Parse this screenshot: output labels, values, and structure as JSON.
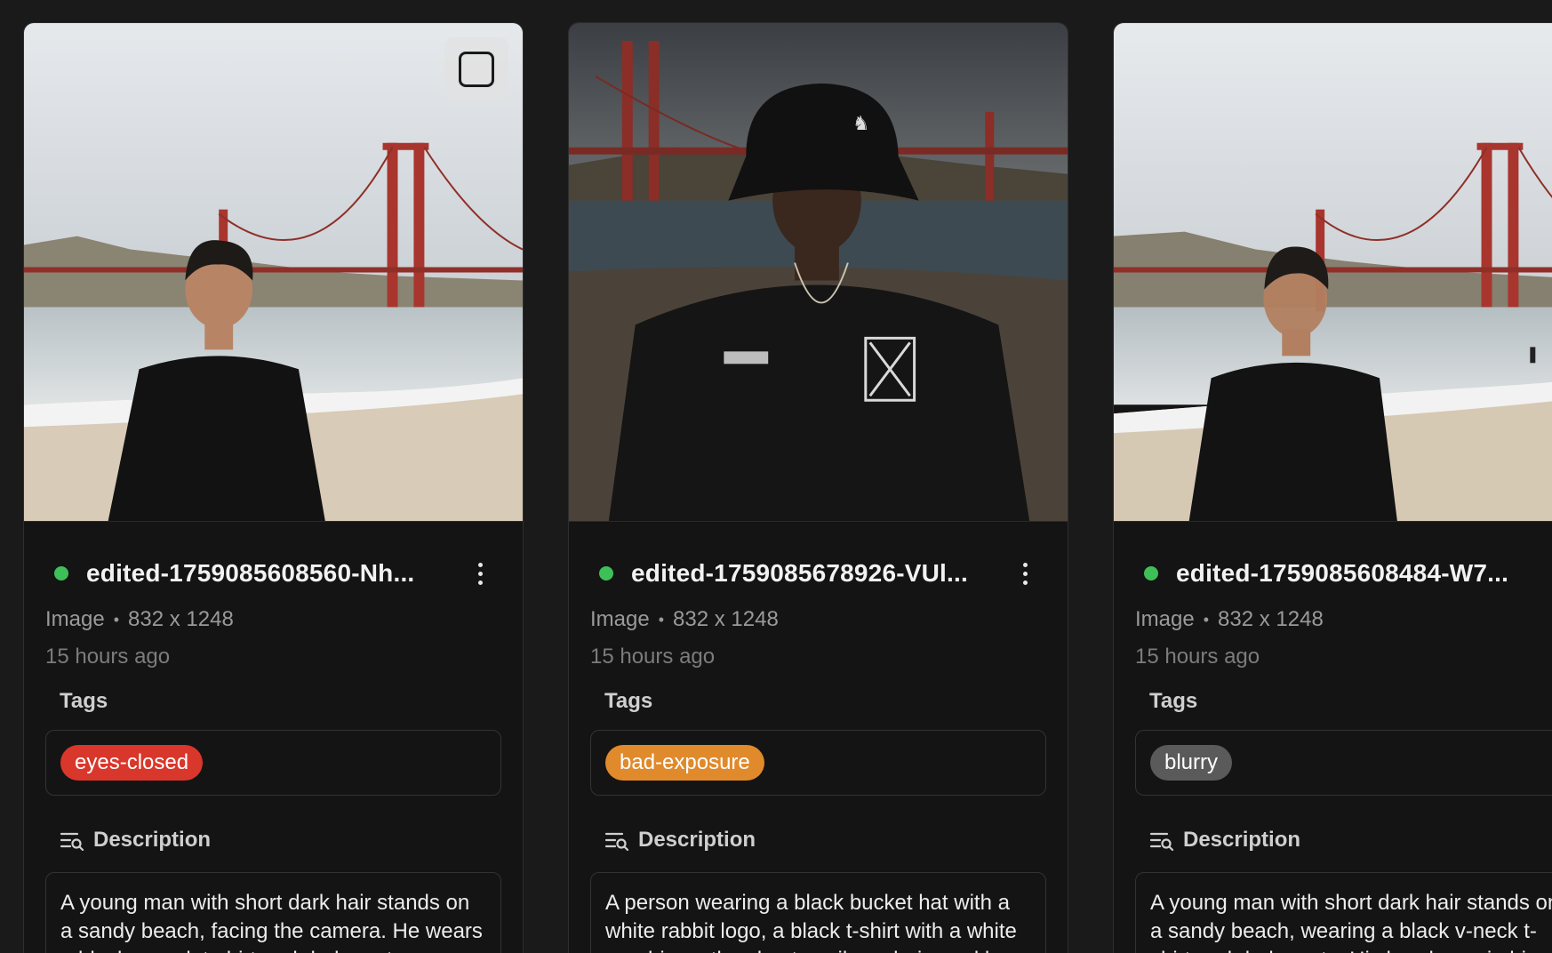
{
  "colors": {
    "status_ok": "#3fbf57",
    "tag_eyes_closed": "#d9372b",
    "tag_bad_exposure": "#e08a2c",
    "tag_blurry": "#5a5a5a"
  },
  "cards": [
    {
      "name": "edited-1759085608560-Nh...",
      "type": "Image",
      "dimensions": "832 x 1248",
      "time": "15 hours ago",
      "tags_label": "Tags",
      "tag": "eyes-closed",
      "tag_color": "#d9372b",
      "description_label": "Description",
      "description": "A young man with short dark hair stands on a sandy beach, facing the camera. He wears a black v-neck t-shirt and dark pants."
    },
    {
      "name": "edited-1759085678926-VUl...",
      "type": "Image",
      "dimensions": "832 x 1248",
      "time": "15 hours ago",
      "tags_label": "Tags",
      "tag": "bad-exposure",
      "tag_color": "#e08a2c",
      "description_label": "Description",
      "description": "A person wearing a black bucket hat with a white rabbit logo, a black t-shirt with a white graphic on the chest, a silver chain necklace."
    },
    {
      "name": "edited-1759085608484-W7...",
      "type": "Image",
      "dimensions": "832 x 1248",
      "time": "15 hours ago",
      "tags_label": "Tags",
      "tag": "blurry",
      "tag_color": "#5a5a5a",
      "description_label": "Description",
      "description": "A young man with short dark hair stands on a sandy beach, wearing a black v-neck t-shirt and dark pants. His hands are in his pockets."
    }
  ]
}
